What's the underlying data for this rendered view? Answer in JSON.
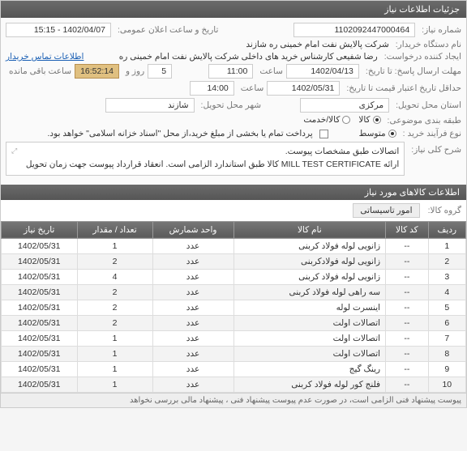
{
  "panel_title": "جزئیات اطلاعات نیاز",
  "labels": {
    "need_no": "شماره نیاز:",
    "announce_dt": "تاریخ و ساعت اعلان عمومی:",
    "org": "نام دستگاه خریدار:",
    "requester": "ایجاد کننده درخواست:",
    "contact_link": "اطلاعات تماس خریدار",
    "resp_deadline": "مهلت ارسال پاسخ: تا تاریخ:",
    "time_word": "ساعت",
    "days_word": "روز و",
    "remain": "ساعت باقی مانده",
    "validity": "حداقل تاریخ اعتبار قیمت تا تاریخ:",
    "loc": "استان محل تحویل:",
    "city": "شهر محل تحویل:",
    "cat": "طبقه بندی موضوعی:",
    "buy_type": "نوع فرآیند خرید :",
    "pay_note": "پرداخت تمام یا بخشی از مبلغ خرید،از محل \"اسناد خزانه اسلامی\" خواهد بود.",
    "desc_label": "شرح کلی نیاز:",
    "items_section": "اطلاعات کالاهای مورد نیاز",
    "group": "گروه کالا:"
  },
  "values": {
    "need_no": "1102092447000464",
    "announce_dt": "1402/04/07 - 15:15",
    "org": "شرکت پالایش نفت امام خمینی  ره  شازند",
    "requester": "رضا  شفیعی  کارشناس خرید های داخلی  شرکت پالایش نفت امام خمینی  ره",
    "resp_date": "1402/04/13",
    "resp_time": "11:00",
    "days_left": "5",
    "time_left": "16:52:14",
    "valid_date": "1402/05/31",
    "valid_time": "14:00",
    "province": "مرکزی",
    "city": "شازند",
    "buy_medium": "متوسط",
    "desc_text": "اتصالات طبق مشخصات پیوست.\nارائه MILL TEST CERTIFICATE کالا طبق استاندارد الزامی است. انعقاد قرارداد پیوست جهت زمان تحویل",
    "group_val": "امور تاسیساتی"
  },
  "cat_options": [
    {
      "label": "کالا",
      "selected": true
    },
    {
      "label": "کالا/خدمت",
      "selected": false
    }
  ],
  "table": {
    "headers": [
      "ردیف",
      "کد کالا",
      "نام کالا",
      "واحد شمارش",
      "تعداد / مقدار",
      "تاریخ نیاز"
    ],
    "rows": [
      [
        "1",
        "--",
        "زانویی لوله فولاد کربنی",
        "عدد",
        "1",
        "1402/05/31"
      ],
      [
        "2",
        "--",
        "زانویی لوله فولادکربنی",
        "عدد",
        "2",
        "1402/05/31"
      ],
      [
        "3",
        "--",
        "زانویی لوله فولاد کربنی",
        "عدد",
        "4",
        "1402/05/31"
      ],
      [
        "4",
        "--",
        "سه راهی لوله فولاد کربنی",
        "عدد",
        "2",
        "1402/05/31"
      ],
      [
        "5",
        "--",
        "اینسرت لوله",
        "عدد",
        "2",
        "1402/05/31"
      ],
      [
        "6",
        "--",
        "اتصالات اولت",
        "عدد",
        "2",
        "1402/05/31"
      ],
      [
        "7",
        "--",
        "اتصالات اولت",
        "عدد",
        "1",
        "1402/05/31"
      ],
      [
        "8",
        "--",
        "اتصالات اولت",
        "عدد",
        "1",
        "1402/05/31"
      ],
      [
        "9",
        "--",
        "رینگ گیج",
        "عدد",
        "1",
        "1402/05/31"
      ],
      [
        "10",
        "--",
        "فلنج کور لوله فولاد کربنی",
        "عدد",
        "1",
        "1402/05/31"
      ]
    ]
  },
  "footer": "پیوست پیشنهاد فنی الزامی است، در صورت عدم پیوست پیشنهاد فنی ، پیشنهاد مالی بررسی نخواهد"
}
